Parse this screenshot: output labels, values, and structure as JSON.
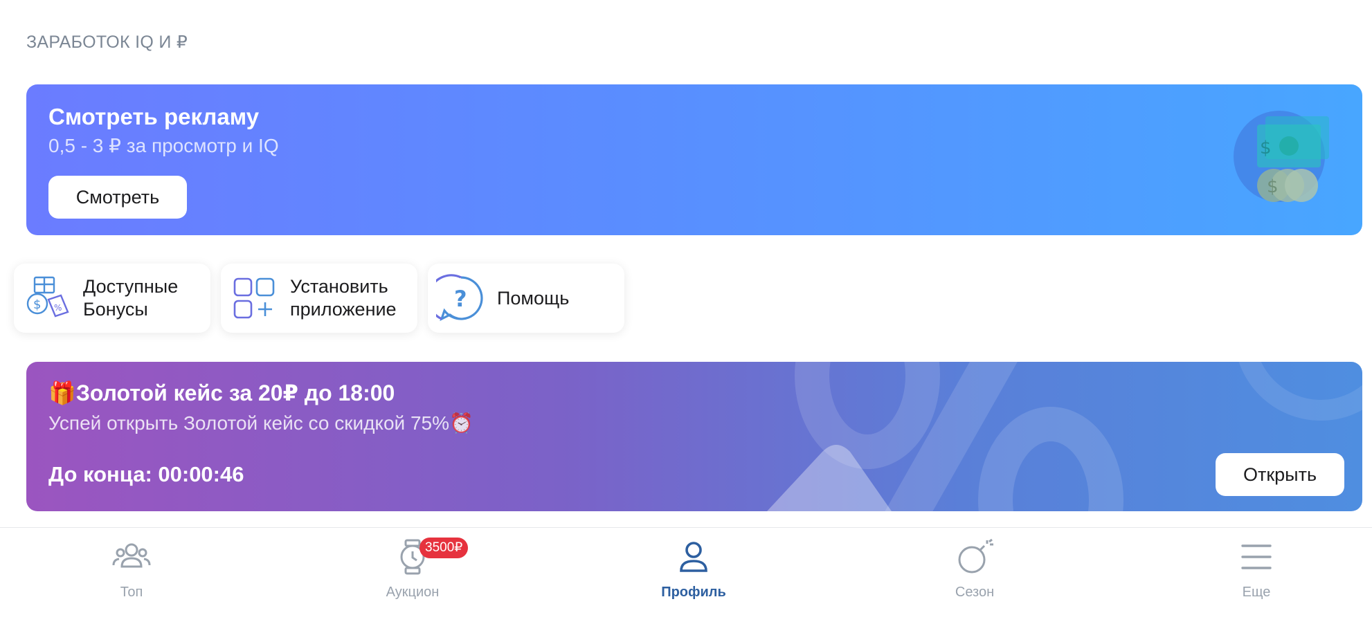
{
  "section": {
    "title": "ЗАРАБОТОК IQ И ₽"
  },
  "ad": {
    "title": "Смотреть рекламу",
    "subtitle": "0,5 - 3 ₽ за просмотр и IQ",
    "button": "Смотреть",
    "icon": "money-coins-icon"
  },
  "tiles": [
    {
      "line1": "Доступные",
      "line2": "Бонусы",
      "icon": "bonus-gift-icon"
    },
    {
      "line1": "Установить",
      "line2": "приложение",
      "icon": "install-app-icon"
    },
    {
      "line1": "Помощь",
      "line2": "",
      "icon": "help-question-icon"
    }
  ],
  "promo": {
    "title": "🎁Золотой кейс за 20₽ до 18:00",
    "subtitle": "Успей открыть Золотой кейс со скидкой 75%⏰",
    "timer": "До конца: 00:00:46",
    "button": "Открыть"
  },
  "nav": {
    "items": [
      {
        "label": "Топ",
        "icon": "users-group-icon"
      },
      {
        "label": "Аукцион",
        "icon": "watch-icon",
        "badge": "3500₽"
      },
      {
        "label": "Профиль",
        "icon": "profile-icon",
        "active": true
      },
      {
        "label": "Сезон",
        "icon": "bomb-icon"
      },
      {
        "label": "Еще",
        "icon": "menu-icon"
      }
    ]
  },
  "colors": {
    "accent": "#2d5fa0",
    "ad_gradient": [
      "#6b7cff",
      "#48a6ff"
    ],
    "promo_gradient": [
      "#9b55c0",
      "#4f8ee0"
    ],
    "badge": "#e6323e"
  }
}
